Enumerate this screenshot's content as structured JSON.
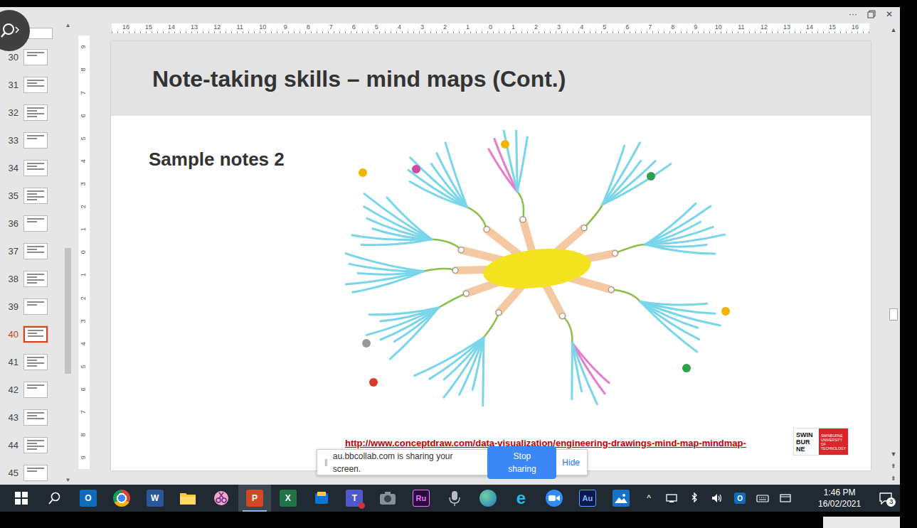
{
  "app_window": {
    "menu": "···",
    "close": "✕"
  },
  "slide_panel": {
    "slides": [
      {
        "number": "30",
        "selected": false
      },
      {
        "number": "31",
        "selected": false
      },
      {
        "number": "32",
        "selected": false
      },
      {
        "number": "33",
        "selected": false
      },
      {
        "number": "34",
        "selected": false
      },
      {
        "number": "35",
        "selected": false
      },
      {
        "number": "36",
        "selected": false
      },
      {
        "number": "37",
        "selected": false
      },
      {
        "number": "38",
        "selected": false
      },
      {
        "number": "39",
        "selected": false
      },
      {
        "number": "40",
        "selected": true
      },
      {
        "number": "41",
        "selected": false
      },
      {
        "number": "42",
        "selected": false
      },
      {
        "number": "43",
        "selected": false
      },
      {
        "number": "44",
        "selected": false
      },
      {
        "number": "45",
        "selected": false
      }
    ],
    "scroll_up": "▲",
    "scroll_down": "▼",
    "level": 0.68
  },
  "rulers": {
    "horizontal": [
      "16",
      "15",
      "14",
      "13",
      "12",
      "11",
      "10",
      "9",
      "8",
      "7",
      "6",
      "5",
      "4",
      "3",
      "2",
      "1",
      "0",
      "1",
      "2",
      "3",
      "4",
      "5",
      "6",
      "7",
      "8",
      "9",
      "10",
      "11",
      "12",
      "13",
      "14",
      "15",
      "16"
    ],
    "vertical": [
      "9",
      "8",
      "7",
      "6",
      "5",
      "4",
      "3",
      "2",
      "1",
      "0",
      "1",
      "2",
      "3",
      "4",
      "5",
      "6",
      "7",
      "8",
      "9"
    ]
  },
  "slide": {
    "title": "Note-taking skills – mind maps (Cont.)",
    "subtitle": "Sample notes 2",
    "link": "http://www.conceptdraw.com/data-visualization/engineering-drawings-mind-map-mindmap-",
    "logo": [
      "SWIN",
      "BUR",
      "NE"
    ],
    "logo_caption": "SWINBURNE UNIVERSITY OF TECHNOLOGY"
  },
  "editor_scrollbar": {
    "up": "▲",
    "down": "▼",
    "prev_slide": "⇞",
    "next_slide": "⇟",
    "level": 0.68
  },
  "sharing_bar": {
    "grip": "||",
    "message": "au.bbcollab.com is sharing your screen.",
    "stop": "Stop sharing",
    "hide": "Hide"
  },
  "taskbar": {
    "apps": [
      {
        "kind": "windows",
        "selected": false
      },
      {
        "kind": "search",
        "selected": false
      },
      {
        "kind": "outlook",
        "label": "O",
        "selected": false
      },
      {
        "kind": "chrome",
        "selected": false
      },
      {
        "kind": "word",
        "label": "W",
        "selected": false
      },
      {
        "kind": "explorer",
        "selected": false
      },
      {
        "kind": "snip",
        "selected": false
      },
      {
        "kind": "powerpoint",
        "label": "P",
        "selected": true
      },
      {
        "kind": "excel",
        "label": "X",
        "selected": false
      },
      {
        "kind": "files",
        "selected": false
      },
      {
        "kind": "teams",
        "label": "T",
        "selected": false
      },
      {
        "kind": "camera",
        "selected": false
      },
      {
        "kind": "rush",
        "label": "Ru",
        "selected": false
      },
      {
        "kind": "mic",
        "selected": false
      },
      {
        "kind": "globe",
        "selected": false
      },
      {
        "kind": "ie",
        "label": "e",
        "selected": false
      },
      {
        "kind": "zoom",
        "selected": false
      },
      {
        "kind": "audition",
        "label": "Au",
        "selected": false
      },
      {
        "kind": "photos",
        "selected": false
      }
    ],
    "tray": {
      "icons": [
        {
          "kind": "chevron",
          "label": "^"
        },
        {
          "kind": "device"
        },
        {
          "kind": "bluetooth"
        },
        {
          "kind": "volume"
        },
        {
          "kind": "outlook",
          "label": "O"
        },
        {
          "kind": "keyboard"
        },
        {
          "kind": "taskview"
        }
      ],
      "time": "1:46 PM",
      "date": "16/02/2021",
      "notifications": "3"
    }
  }
}
